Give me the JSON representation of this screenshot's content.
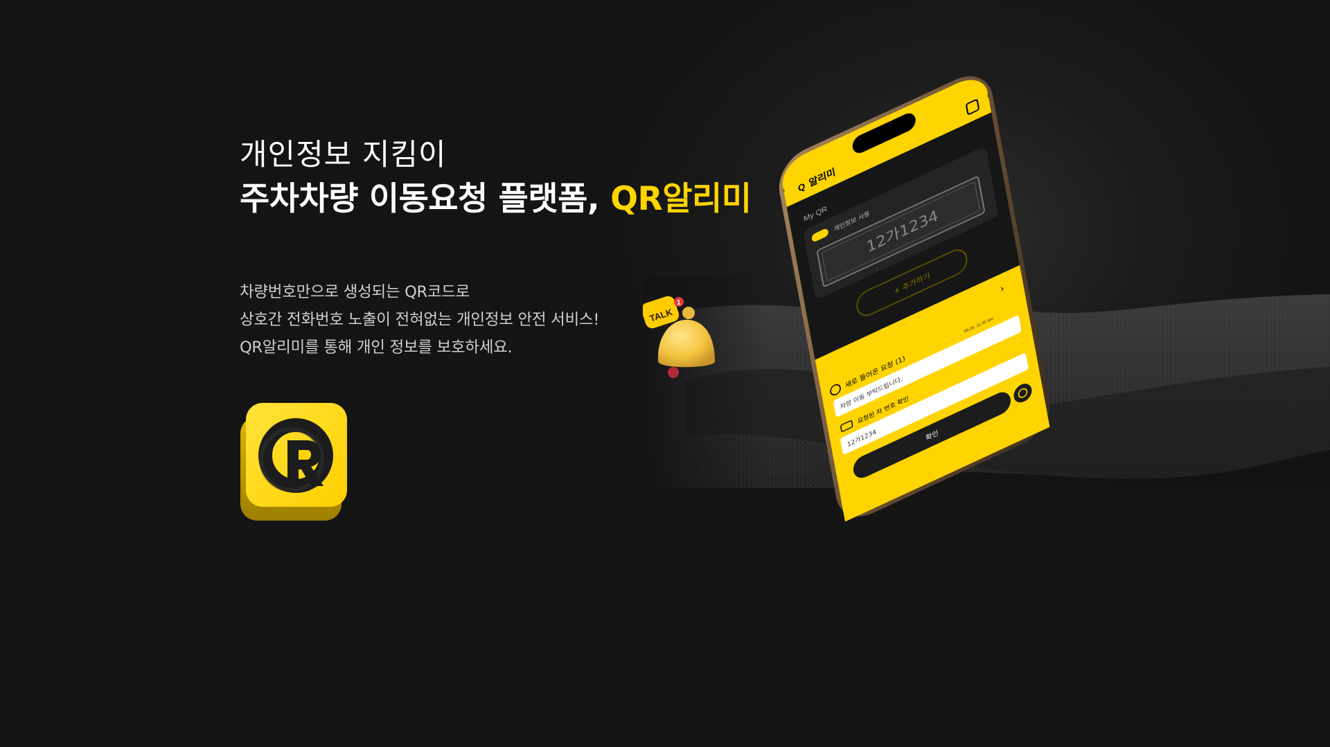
{
  "hero": {
    "subtitle": "개인정보 지킴이",
    "title_main": "주차차량 이동요청 플랫폼, ",
    "title_accent": "QR알리미",
    "description": [
      "차량번호만으로 생성되는 QR코드로",
      "상호간 전화번호 노출이 전혀없는 개인정보 안전 서비스!",
      "QR알리미를 통해 개인 정보를 보호하세요."
    ]
  },
  "phone_screen": {
    "app_name": "알리미",
    "my_qr_label": "My QR",
    "toggle_label": "개인정보 사용",
    "plate_number": "12가1234",
    "add_button": "+ 추가하기",
    "notification_title": "새로 들어온 요청 (1)",
    "notification_time": "08.26. 11:30 am",
    "message_text": "차량 이동 부탁드립니다.",
    "requested_plate_label": "요청된 차 번호 확인",
    "requested_plate": "12가1234",
    "confirm_button": "확인"
  },
  "bell_badge": {
    "talk_label": "TALK",
    "count": "1"
  },
  "colors": {
    "background": "#141414",
    "accent": "#ffd400",
    "text": "#ffffff",
    "desc_text": "#d0d0d0"
  }
}
